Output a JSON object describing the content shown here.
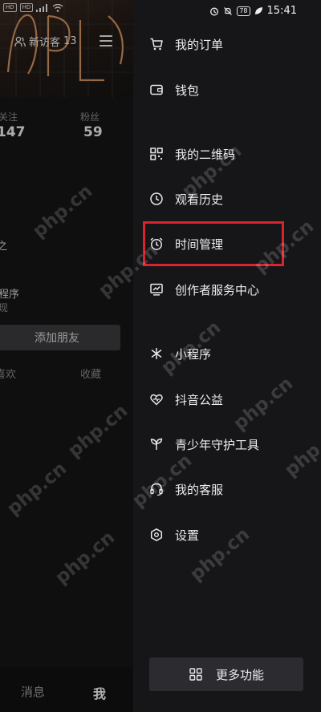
{
  "status": {
    "time": "15:41",
    "battery": "78",
    "left_chips": [
      "HD",
      "HD"
    ]
  },
  "profile": {
    "visitors_label": "新访客",
    "visitors_count": "13",
    "stats": [
      {
        "label": "关注",
        "value": "147"
      },
      {
        "label": "粉丝",
        "value": "59"
      }
    ],
    "partial_1": "之",
    "partial_2": "程序",
    "partial_3": "现",
    "add_friend": "添加朋友",
    "tabs": [
      "喜欢",
      "收藏"
    ],
    "bottom_nav": {
      "messages": "消息",
      "me": "我"
    }
  },
  "drawer": {
    "items": [
      {
        "label": "我的订单",
        "icon": "cart-icon"
      },
      {
        "label": "钱包",
        "icon": "wallet-icon"
      },
      {
        "label": "我的二维码",
        "icon": "qrcode-icon"
      },
      {
        "label": "观看历史",
        "icon": "history-icon"
      },
      {
        "label": "时间管理",
        "icon": "alarm-clock-icon"
      },
      {
        "label": "创作者服务中心",
        "icon": "creator-chart-icon"
      },
      {
        "label": "小程序",
        "icon": "mini-program-icon"
      },
      {
        "label": "抖音公益",
        "icon": "charity-heart-icon"
      },
      {
        "label": "青少年守护工具",
        "icon": "sprout-icon"
      },
      {
        "label": "我的客服",
        "icon": "headset-icon"
      },
      {
        "label": "设置",
        "icon": "settings-hexagon-icon"
      }
    ],
    "more": "更多功能"
  },
  "watermark": "php.cn",
  "colors": {
    "highlight": "#d9232d",
    "background": "#161619"
  }
}
